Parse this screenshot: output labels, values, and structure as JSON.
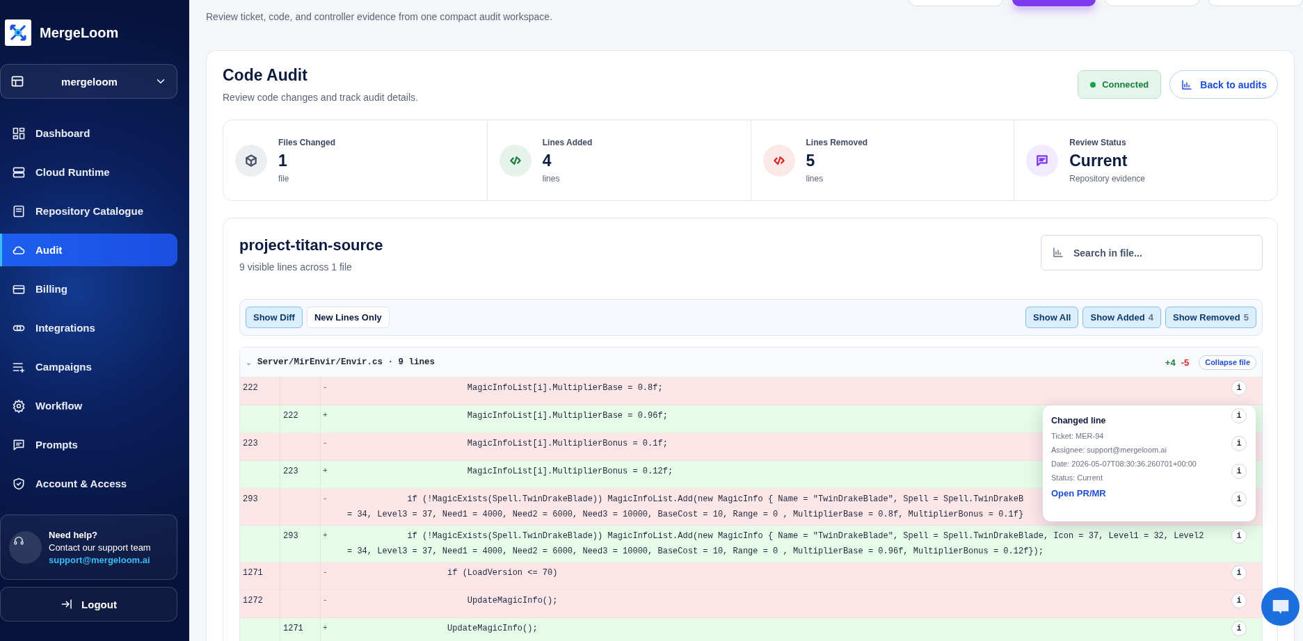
{
  "sidebar": {
    "brand": "MergeLoom",
    "workspace": "mergeloom",
    "nav": [
      {
        "label": "Dashboard",
        "selected": false
      },
      {
        "label": "Cloud Runtime",
        "selected": false
      },
      {
        "label": "Repository Catalogue",
        "selected": false
      },
      {
        "label": "Audit",
        "selected": true
      },
      {
        "label": "Billing",
        "selected": false
      },
      {
        "label": "Integrations",
        "selected": false
      },
      {
        "label": "Campaigns",
        "selected": false
      },
      {
        "label": "Workflow",
        "selected": false
      },
      {
        "label": "Prompts",
        "selected": false
      },
      {
        "label": "Account & Access",
        "selected": false
      }
    ],
    "help": {
      "title": "Need help?",
      "text": "Contact our support team",
      "email": "support@mergeloom.ai"
    },
    "logout": "Logout"
  },
  "intro": "Review ticket, code, and controller evidence from one compact audit workspace.",
  "audit": {
    "title": "Code Audit",
    "subtitle": "Review code changes and track audit details.",
    "status": "Connected",
    "back_button": "Back to audits"
  },
  "stats": [
    {
      "label": "Files Changed",
      "value": "1",
      "unit": "file",
      "color": "#475569"
    },
    {
      "label": "Lines Added",
      "value": "4",
      "unit": "lines",
      "color": "#15803d"
    },
    {
      "label": "Lines Removed",
      "value": "5",
      "unit": "lines",
      "color": "#dc2626"
    },
    {
      "label": "Review Status",
      "value": "Current",
      "unit": "Repository evidence",
      "color": "#7c3aed"
    }
  ],
  "repository": {
    "title": "project-titan-source",
    "subtitle": "9 visible lines across 1 file",
    "search": {
      "placeholder": "Search in file..."
    },
    "view_modes": [
      {
        "label": "Show Diff",
        "selected": true
      },
      {
        "label": "New Lines Only",
        "selected": false
      }
    ],
    "filters": [
      {
        "label": "Show All",
        "selected": true
      },
      {
        "label": "Show Added",
        "count": "4",
        "selected": true
      },
      {
        "label": "Show Removed",
        "count": "5",
        "selected": true
      }
    ],
    "file": {
      "toggle": "⌄",
      "path": "Server/MirEnvir/Envir.cs · 9 lines",
      "expanded": true,
      "added": "+4",
      "removed": "-5",
      "collapse_button": "Collapse file",
      "rows": [
        {
          "kind": "removed",
          "old": "222",
          "sign": "-",
          "lines": [
            "                        MagicInfoList[i].MultiplierBase = 0.8f;"
          ],
          "info": "i"
        },
        {
          "kind": "added",
          "new": "222",
          "sign": "+",
          "lines": [
            "                        MagicInfoList[i].MultiplierBase = 0.96f;"
          ],
          "info": "i"
        },
        {
          "kind": "removed",
          "old": "223",
          "sign": "-",
          "lines": [
            "                        MagicInfoList[i].MultiplierBonus = 0.1f;"
          ],
          "info": "i"
        },
        {
          "kind": "added",
          "new": "223",
          "sign": "+",
          "lines": [
            "                        MagicInfoList[i].MultiplierBonus = 0.12f;"
          ],
          "info": "i"
        },
        {
          "kind": "removed",
          "old": "293",
          "sign": "-",
          "lines": [
            "            if (!MagicExists(Spell.TwinDrakeBlade)) MagicInfoList.Add(new MagicInfo { Name = \"TwinDrakeBlade\", Spell = Spell.TwinDrakeB",
            "= 34, Level3 = 37, Need1 = 4000, Need2 = 6000, Need3 = 10000, BaseCost = 10, Range = 0 , MultiplierBase = 0.8f, MultiplierBonus = 0.1f}"
          ],
          "info": "i"
        },
        {
          "kind": "added",
          "new": "293",
          "sign": "+",
          "lines": [
            "            if (!MagicExists(Spell.TwinDrakeBlade)) MagicInfoList.Add(new MagicInfo { Name = \"TwinDrakeBlade\", Spell = Spell.TwinDrakeBlade, Icon = 37, Level1 = 32, Level2",
            "= 34, Level3 = 37, Need1 = 4000, Need2 = 6000, Need3 = 10000, BaseCost = 10, Range = 0 , MultiplierBase = 0.96f, MultiplierBonus = 0.12f});"
          ],
          "info": "i"
        },
        {
          "kind": "removed",
          "old": "1271",
          "sign": "-",
          "lines": [
            "                    if (LoadVersion <= 70)"
          ],
          "info": "i"
        },
        {
          "kind": "removed",
          "old": "1272",
          "sign": "-",
          "lines": [
            "                        UpdateMagicInfo();"
          ],
          "info": "i"
        },
        {
          "kind": "added",
          "new": "1271",
          "sign": "+",
          "lines": [
            "                    UpdateMagicInfo();"
          ],
          "info": "i"
        }
      ]
    },
    "popover": {
      "title": "Changed line",
      "details": [
        "Ticket: MER-94",
        "Assignee: support@mergeloom.ai",
        "Date: 2026-05-07T08:30:36.260701+00:00",
        "Status: Current"
      ],
      "link": "Open PR/MR"
    }
  }
}
